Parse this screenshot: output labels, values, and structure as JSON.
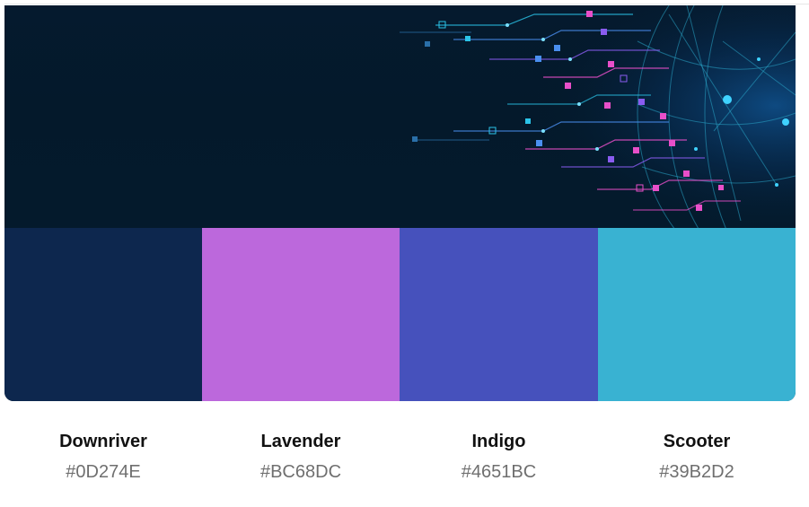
{
  "palette": {
    "colors": [
      {
        "name": "Downriver",
        "hex_label": "#0D274E",
        "color": "#0D274E"
      },
      {
        "name": "Lavender",
        "hex_label": "#BC68DC",
        "color": "#BC68DC"
      },
      {
        "name": "Indigo",
        "hex_label": "#4651BC",
        "color": "#4651BC"
      },
      {
        "name": "Scooter",
        "hex_label": "#39B2D2",
        "color": "#39B2D2"
      }
    ]
  },
  "hero_image": {
    "icon": "circuit-globe-artwork",
    "accent_colors": [
      "#2bc4e8",
      "#e84fc9",
      "#8a5cf0",
      "#4a8ff0"
    ]
  }
}
